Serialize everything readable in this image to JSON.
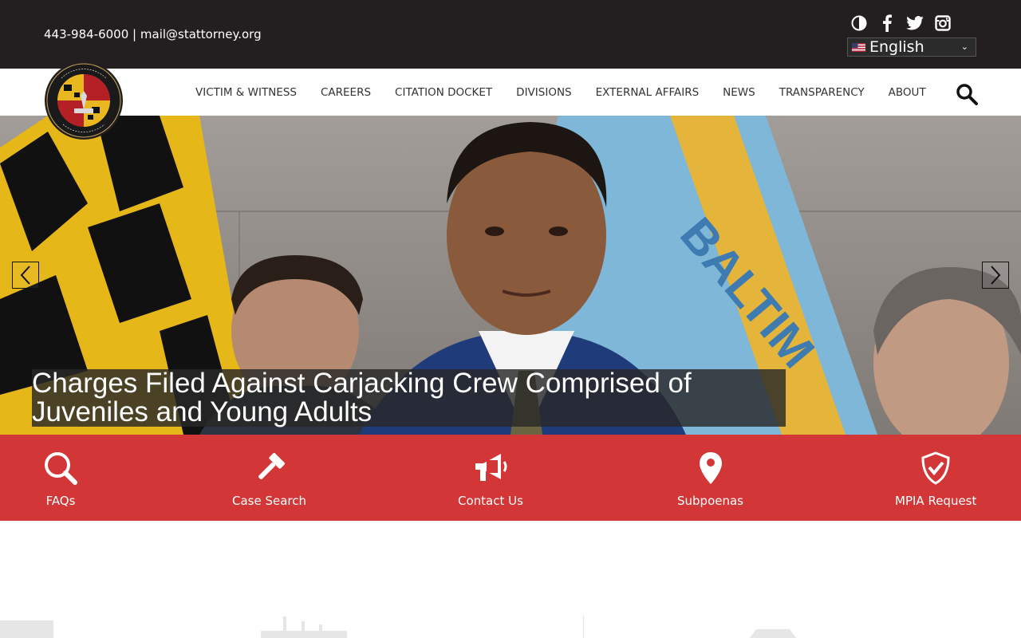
{
  "topbar": {
    "phone": "443-984-6000",
    "separator": "|",
    "email": "mail@stattorney.org",
    "social_icons": [
      "contrast-icon",
      "facebook-icon",
      "twitter-icon",
      "instagram-icon"
    ],
    "language": {
      "selected": "English"
    }
  },
  "nav": {
    "logo_text": "OFFICE OF THE STATE'S ATTORNEY FOR BALTIMORE CITY",
    "items": [
      {
        "label": "VICTIM & WITNESS"
      },
      {
        "label": "CAREERS"
      },
      {
        "label": "CITATION DOCKET"
      },
      {
        "label": "DIVISIONS"
      },
      {
        "label": "EXTERNAL AFFAIRS"
      },
      {
        "label": "NEWS"
      },
      {
        "label": "TRANSPARENCY"
      },
      {
        "label": "ABOUT"
      }
    ]
  },
  "hero": {
    "caption": "Charges Filed Against Carjacking Crew Comprised of Juveniles and Young Adults",
    "flag_text": "BALTIM"
  },
  "quick_links": [
    {
      "label": "FAQs",
      "icon": "search-icon"
    },
    {
      "label": "Case Search",
      "icon": "gavel-icon"
    },
    {
      "label": "Contact Us",
      "icon": "megaphone-icon"
    },
    {
      "label": "Subpoenas",
      "icon": "map-pin-icon"
    },
    {
      "label": "MPIA Request",
      "icon": "shield-check-icon"
    }
  ],
  "colors": {
    "topbar": "#231f20",
    "accent_red": "#d33636",
    "nav_text": "#333333"
  }
}
